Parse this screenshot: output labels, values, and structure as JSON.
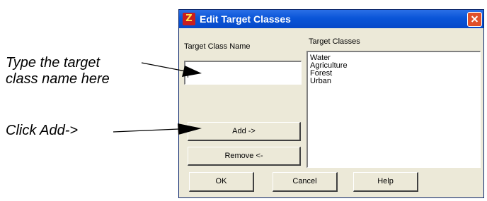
{
  "annotations": {
    "line1": "Type the target",
    "line2": "class name here",
    "line3": "Click Add->"
  },
  "dialog": {
    "title": "Edit Target Classes",
    "title_icon_glyph": "Z",
    "title_icon_name": "app-icon",
    "close_icon_name": "close-icon",
    "target_class_name_label": "Target Class Name",
    "target_class_name_value": "",
    "target_classes_label": "Target Classes",
    "target_classes": [
      "Water",
      "Agriculture",
      "Forest",
      "Urban"
    ],
    "add_label": "Add ->",
    "remove_label": "Remove <-",
    "ok_label": "OK",
    "cancel_label": "Cancel",
    "help_label": "Help"
  },
  "colors": {
    "titlebar": "#0a55d8",
    "dialog_background": "#ece9d8",
    "close_button": "#e0502a"
  }
}
